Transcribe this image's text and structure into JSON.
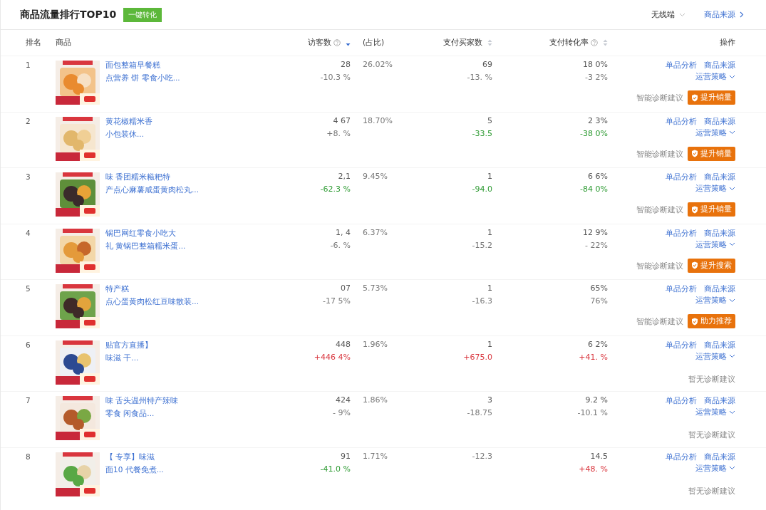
{
  "header": {
    "title": "商品流量排行TOP10",
    "convert_button": "一键转化",
    "device_select": "无线端",
    "source_link": "商品来源"
  },
  "table": {
    "columns": [
      {
        "label": "排名"
      },
      {
        "label": "商品"
      },
      {
        "label": "访客数",
        "help": true,
        "sortable": true,
        "sorted": true
      },
      {
        "label": "(占比)"
      },
      {
        "label": "支付买家数",
        "sortable": true,
        "sorted": false
      },
      {
        "label": "支付转化率",
        "help": true,
        "sortable": true,
        "sorted": false
      },
      {
        "label": "操作"
      }
    ],
    "rows": [
      {
        "rank": "1",
        "title": [
          "面包整箱早餐糕",
          "点营养 饼 零食小吃..."
        ],
        "visitors": {
          "value": "28",
          "change": "-10.3 %",
          "color": "#777777"
        },
        "share": "26.02%",
        "buyers": {
          "value": "69",
          "change": "-13. %",
          "color": "#777777"
        },
        "rate": {
          "value": "18 0%",
          "change": "-3 2%",
          "color": "#777777"
        },
        "links": [
          "单品分析",
          "商品来源"
        ],
        "strategy": "运营策略",
        "diagnosis": {
          "kind": "action",
          "label": "智能诊断建议",
          "button": "提升销量"
        }
      },
      {
        "rank": "2",
        "title": [
          "黄花椒糯米香",
          "小包装休..."
        ],
        "visitors": {
          "value": "4 67",
          "change": "+8. %",
          "color": "#777777"
        },
        "share": "18.70%",
        "buyers": {
          "value": "5",
          "change": "-33.5",
          "color": "#2e9b33"
        },
        "rate": {
          "value": "2 3%",
          "change": "-38 0%",
          "color": "#2e9b33"
        },
        "links": [
          "单品分析",
          "商品来源"
        ],
        "strategy": "运营策略",
        "diagnosis": {
          "kind": "action",
          "label": "智能诊断建议",
          "button": "提升销量"
        }
      },
      {
        "rank": "3",
        "title": [
          "味 香团糯米糍粑特",
          "产点心麻薯咸蛋黄肉松丸..."
        ],
        "visitors": {
          "value": "2,1",
          "change": "-62.3 %",
          "color": "#2e9b33"
        },
        "share": "9.45%",
        "buyers": {
          "value": "1",
          "change": "-94.0",
          "color": "#2e9b33"
        },
        "rate": {
          "value": "6 6%",
          "change": "-84 0%",
          "color": "#2e9b33"
        },
        "links": [
          "单品分析",
          "商品来源"
        ],
        "strategy": "运营策略",
        "diagnosis": {
          "kind": "action",
          "label": "智能诊断建议",
          "button": "提升销量"
        }
      },
      {
        "rank": "4",
        "title": [
          "锅巴网红零食小吃大",
          "礼 黄锅巴整箱糯米蛋..."
        ],
        "visitors": {
          "value": "1, 4",
          "change": "-6. %",
          "color": "#777777"
        },
        "share": "6.37%",
        "buyers": {
          "value": "1",
          "change": "-15.2",
          "color": "#777777"
        },
        "rate": {
          "value": "12 9%",
          "change": "- 22%",
          "color": "#777777"
        },
        "links": [
          "单品分析",
          "商品来源"
        ],
        "strategy": "运营策略",
        "diagnosis": {
          "kind": "action",
          "label": "智能诊断建议",
          "button": "提升搜索"
        }
      },
      {
        "rank": "5",
        "title": [
          "特产糕",
          "点心蛋黄肉松红豆味散装..."
        ],
        "visitors": {
          "value": "07",
          "change": "-17 5%",
          "color": "#777777"
        },
        "share": "5.73%",
        "buyers": {
          "value": "1",
          "change": "-16.3",
          "color": "#777777"
        },
        "rate": {
          "value": "65%",
          "change": "76%",
          "color": "#777777"
        },
        "links": [
          "单品分析",
          "商品来源"
        ],
        "strategy": "运营策略",
        "diagnosis": {
          "kind": "action",
          "label": "智能诊断建议",
          "button": "助力推荐"
        }
      },
      {
        "rank": "6",
        "title": [
          "贴官方直播】",
          "味滋 干..."
        ],
        "visitors": {
          "value": "448",
          "change": "+446 4%",
          "color": "#d9363e"
        },
        "share": "1.96%",
        "buyers": {
          "value": "1",
          "change": "+675.0",
          "color": "#d9363e"
        },
        "rate": {
          "value": "6 2%",
          "change": "+41. %",
          "color": "#d9363e"
        },
        "links": [
          "单品分析",
          "商品来源"
        ],
        "strategy": "运营策略",
        "diagnosis": {
          "kind": "none",
          "label": "暂无诊断建议"
        }
      },
      {
        "rank": "7",
        "title": [
          "味 舌头温州特产辣味",
          "零食 闲食品..."
        ],
        "visitors": {
          "value": "424",
          "change": "- 9%",
          "color": "#777777"
        },
        "share": "1.86%",
        "buyers": {
          "value": "3",
          "change": "-18.75",
          "color": "#777777"
        },
        "rate": {
          "value": "9.2 %",
          "change": "-10.1 %",
          "color": "#777777"
        },
        "links": [
          "单品分析",
          "商品来源"
        ],
        "strategy": "运营策略",
        "diagnosis": {
          "kind": "none",
          "label": "暂无诊断建议"
        }
      },
      {
        "rank": "8",
        "title": [
          "【 专享】味滋",
          "面10 代餐免煮..."
        ],
        "visitors": {
          "value": "91",
          "change": "-41.0 %",
          "color": "#2e9b33"
        },
        "share": "1.71%",
        "buyers": {
          "change": "-12.3",
          "color": "#777777"
        },
        "rate": {
          "value": "14.5",
          "change": "+48. %",
          "color": "#d9363e"
        },
        "links": [
          "单品分析",
          "商品来源"
        ],
        "strategy": "运营策略",
        "diagnosis": {
          "kind": "none",
          "label": "暂无诊断建议"
        }
      }
    ]
  }
}
